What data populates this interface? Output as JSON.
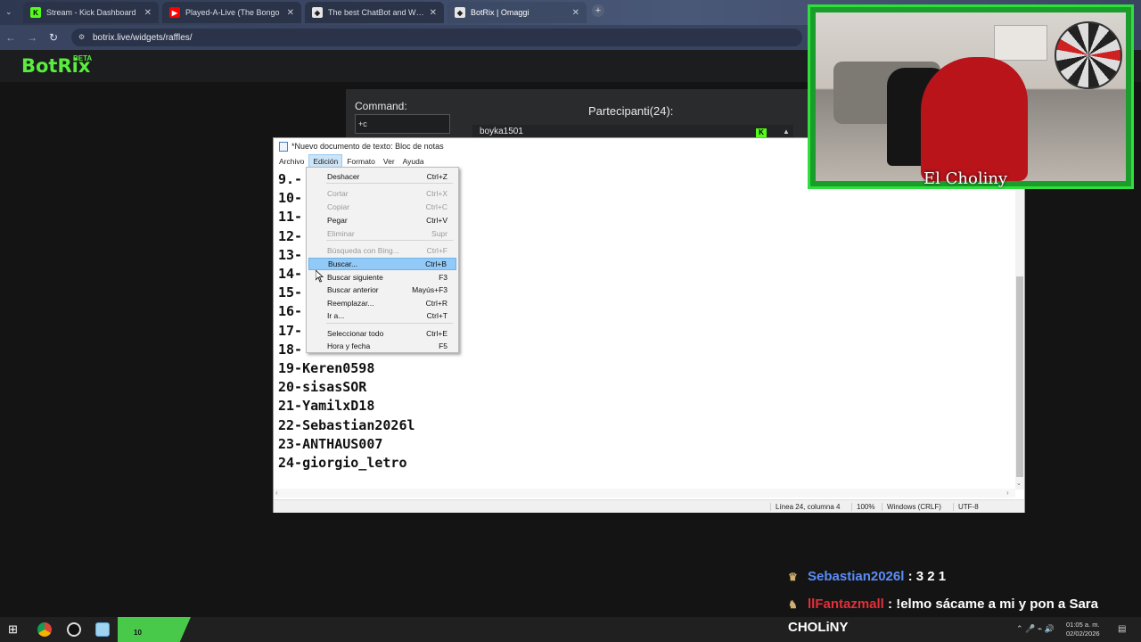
{
  "browser": {
    "tabs": [
      {
        "label": "Stream - Kick Dashboard",
        "favicon": "kick-icon",
        "color": "#53fc18"
      },
      {
        "label": "Played-A-Live (The Bongo",
        "favicon": "youtube-icon",
        "color": "#ff0000"
      },
      {
        "label": "The best ChatBot and Widgets",
        "favicon": "botrix-icon",
        "color": "#2a2a2a"
      },
      {
        "label": "BotRix | Omaggi",
        "favicon": "botrix-icon",
        "color": "#2a2a2a"
      }
    ],
    "url": "botrix.live/widgets/raffles/"
  },
  "botrix": {
    "logo": "BotRix",
    "beta": "BETA",
    "command_label": "Command:",
    "command_value": "+c",
    "participants_label": "Partecipanti(24):",
    "first_participant": "boyka1501",
    "accent_color": "#5aed3f"
  },
  "notepad": {
    "title": "*Nuevo documento de texto: Bloc de notas",
    "menu": [
      "Archivo",
      "Edición",
      "Formato",
      "Ver",
      "Ayuda"
    ],
    "lines": [
      "9.-",
      "10-",
      "11-",
      "12-",
      "13-",
      "14-",
      "15-",
      "16-",
      "17-",
      "18-",
      "19-Keren0598",
      "20-sisasSOR",
      "21-YamilxD18",
      "22-Sebastian2026l",
      "23-ANTHAUS007",
      "24-giorgio_letro"
    ],
    "status": {
      "position": "Línea 24, columna 4",
      "zoom": "100%",
      "line_ending": "Windows (CRLF)",
      "encoding": "UTF-8"
    }
  },
  "edit_menu": [
    {
      "label": "Deshacer",
      "shortcut": "Ctrl+Z",
      "enabled": true
    },
    {
      "label": "Cortar",
      "shortcut": "Ctrl+X",
      "enabled": false
    },
    {
      "label": "Copiar",
      "shortcut": "Ctrl+C",
      "enabled": false
    },
    {
      "label": "Pegar",
      "shortcut": "Ctrl+V",
      "enabled": true
    },
    {
      "label": "Eliminar",
      "shortcut": "Supr",
      "enabled": false
    },
    {
      "label": "Búsqueda con Bing...",
      "shortcut": "Ctrl+F",
      "enabled": false
    },
    {
      "label": "Buscar...",
      "shortcut": "Ctrl+B",
      "enabled": true,
      "highlighted": true
    },
    {
      "label": "Buscar siguiente",
      "shortcut": "F3",
      "enabled": true
    },
    {
      "label": "Buscar anterior",
      "shortcut": "Mayús+F3",
      "enabled": true
    },
    {
      "label": "Reemplazar...",
      "shortcut": "Ctrl+R",
      "enabled": true
    },
    {
      "label": "Ir a...",
      "shortcut": "Ctrl+T",
      "enabled": true
    },
    {
      "label": "Seleccionar todo",
      "shortcut": "Ctrl+E",
      "enabled": true
    },
    {
      "label": "Hora y fecha",
      "shortcut": "F5",
      "enabled": true
    }
  ],
  "webcam": {
    "name": "El Choliny"
  },
  "chat": [
    {
      "user": "Sebastian2026l",
      "message": ": 3 2 1"
    },
    {
      "user": "llFantazmall",
      "message": ": !elmo sácame a mi y pon a Sara"
    },
    {
      "user": "",
      "message": "CHOLiNY"
    }
  ],
  "taskbar": {
    "badge_count": "10",
    "time": "01:05 a. m.",
    "date": "02/02/2026"
  }
}
